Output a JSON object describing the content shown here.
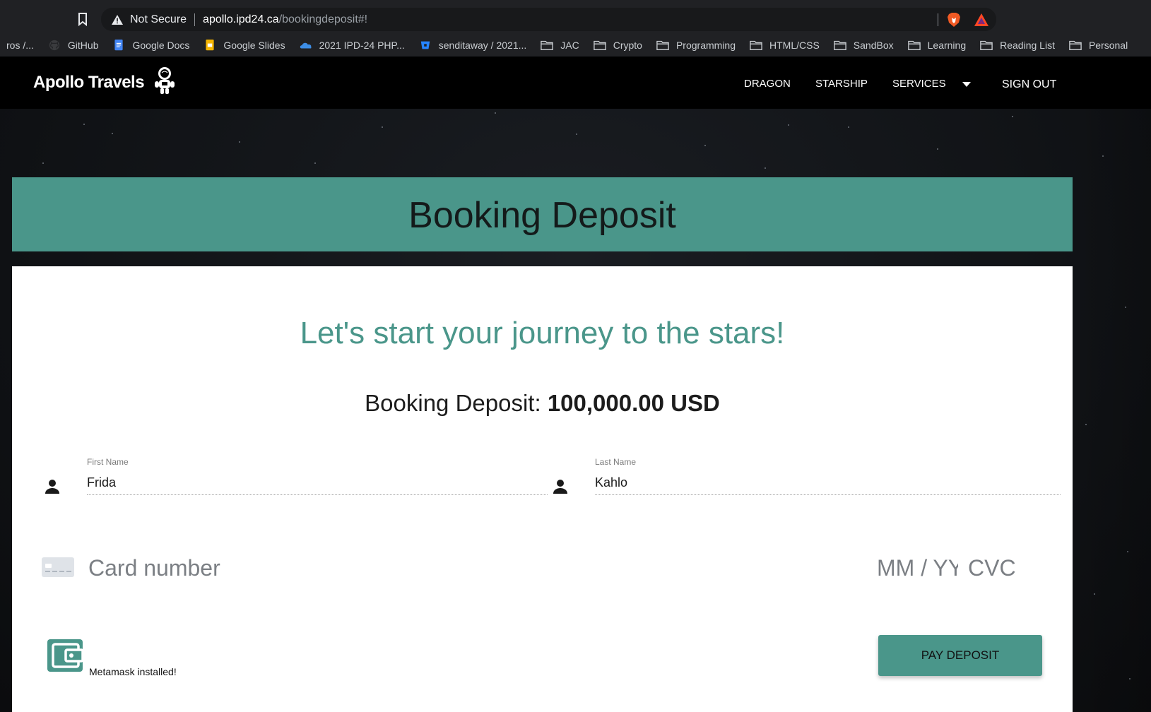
{
  "browser": {
    "security_label": "Not Secure",
    "url_host": "apollo.ipd24.ca",
    "url_path": "/bookingdeposit#!",
    "bookmarks": [
      {
        "label": "ros /...",
        "icon": "truncated-bookmark"
      },
      {
        "label": "GitHub",
        "icon": "github-icon"
      },
      {
        "label": "Google Docs",
        "icon": "google-docs-icon"
      },
      {
        "label": "Google Slides",
        "icon": "google-slides-icon"
      },
      {
        "label": "2021 IPD-24 PHP...",
        "icon": "onedrive-icon"
      },
      {
        "label": "senditaway / 2021...",
        "icon": "bitbucket-icon"
      },
      {
        "label": "JAC",
        "icon": "folder-icon"
      },
      {
        "label": "Crypto",
        "icon": "folder-icon"
      },
      {
        "label": "Programming",
        "icon": "folder-icon"
      },
      {
        "label": "HTML/CSS",
        "icon": "folder-icon"
      },
      {
        "label": "SandBox",
        "icon": "folder-icon"
      },
      {
        "label": "Learning",
        "icon": "folder-icon"
      },
      {
        "label": "Reading List",
        "icon": "folder-icon"
      },
      {
        "label": "Personal",
        "icon": "folder-icon"
      }
    ]
  },
  "nav": {
    "brand": "Apollo Travels",
    "brand_icon": "astronaut-icon",
    "links": {
      "dragon": "DRAGON",
      "starship": "STARSHIP",
      "services": "SERVICES",
      "sign_out": "SIGN OUT"
    }
  },
  "banner": {
    "title": "Booking Deposit"
  },
  "form": {
    "tagline": "Let's start your journey to the stars!",
    "deposit_label": "Booking Deposit:",
    "deposit_amount": "100,000.00 USD",
    "first_name": {
      "label": "First Name",
      "value": "Frida"
    },
    "last_name": {
      "label": "Last Name",
      "value": "Kahlo"
    },
    "card": {
      "number_placeholder": "Card number",
      "expiry_placeholder": "MM / YY",
      "cvc_placeholder": "CVC"
    },
    "wallet_status": "Metamask installed!",
    "pay_button": "PAY DEPOSIT"
  },
  "colors": {
    "accent": "#4a968a",
    "navbar": "#000000",
    "card_bg": "#ffffff"
  }
}
